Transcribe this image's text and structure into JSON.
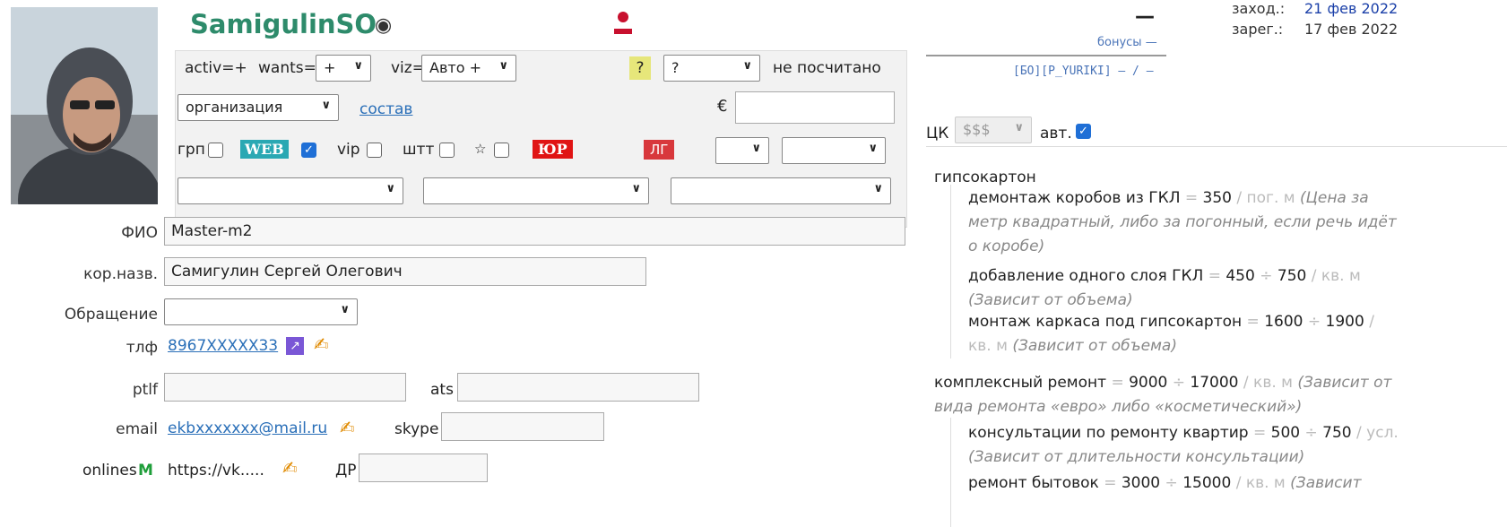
{
  "profile": {
    "username": "SamigulinSO",
    "eye_icon": "eye-icon",
    "person_icon": "person-icon",
    "fio": "Master-m2",
    "corp_name": "Самигулин Сергей Олегович",
    "address_select": "",
    "phone": "8967XXXXX33",
    "ptlf": "",
    "ats": "",
    "email": "ekbxxxxxxx@mail.ru",
    "skype": "",
    "onlines": "https://vk.....",
    "dr": ""
  },
  "labels": {
    "fio": "ФИО",
    "corp": "кор.назв.",
    "address": "Обращение",
    "phone": "тлф",
    "ptlf": "ptlf",
    "ats": "ats",
    "email": "email",
    "skype": "skype",
    "onlines": "onlines",
    "onlines_m": "M",
    "dr": "ДР"
  },
  "panel": {
    "activ": "activ=+",
    "wants_label": "wants=",
    "wants_value": "+",
    "viz_label": "viz=",
    "viz_value": "Авто +",
    "question_badge": "?",
    "question_select": "?",
    "not_counted": "не посчитано",
    "org_select": "организация",
    "sostav": "состав",
    "euro": "€",
    "euro_value": "",
    "grp": "грп",
    "web": "WEB",
    "vip": "vip",
    "sht": "штт",
    "star": "☆",
    "yur": "ЮР",
    "lg": "ЛГ"
  },
  "top_right": {
    "zahod_label": "заход.:",
    "zahod_date": "21 фев 2022",
    "zareg_label": "зарег.:",
    "zareg_date": "17 фев 2022",
    "dash": "—",
    "bonus": "бонусы —",
    "bo_line": "[БО][P_YURIKI] — / —",
    "ck": "ЦК",
    "ck_select": "$$$",
    "avt": "авт."
  },
  "services": {
    "group1": "гипсокартон",
    "s1_name": "демонтаж коробов из ГКЛ",
    "s1_eq": "=",
    "s1_val": "350",
    "s1_unit": "/ пог. м",
    "s1_note": "(Цена за метр квадратный, либо за погонный, если речь идёт о коробе)",
    "s2_name": "добавление одного слоя ГКЛ",
    "s2_val": "450",
    "s2_div": "÷",
    "s2_val2": "750",
    "s2_unit": "/ кв. м",
    "s2_note": "(Зависит от объема)",
    "s3_name": "монтаж каркаса под гипсокартон",
    "s3_val": "1600",
    "s3_val2": "1900",
    "s3_unit": "/ кв. м",
    "s3_note": "(Зависит от объема)",
    "g2_name": "комплексный ремонт",
    "g2_val": "9000",
    "g2_val2": "17000",
    "g2_unit": "/ кв. м",
    "g2_note": "(Зависит от вида ремонта «евро» либо «косметический»)",
    "s4_name": "консультации по ремонту квартир",
    "s4_val": "500",
    "s4_val2": "750",
    "s4_unit": "/ усл.",
    "s4_note": "(Зависит от длительности консультации)",
    "s5_name": "ремонт бытовок",
    "s5_val": "3000",
    "s5_val2": "15000",
    "s5_unit": "/ кв. м",
    "s5_note": "(Зависит"
  },
  "colors": {
    "title": "#2e8b6b",
    "web_badge": "#2aa8b3",
    "yur_badge": "#e01414",
    "lg_badge": "#d8383c",
    "link": "#2a6fb8",
    "date_blue": "#1a3fa8"
  }
}
